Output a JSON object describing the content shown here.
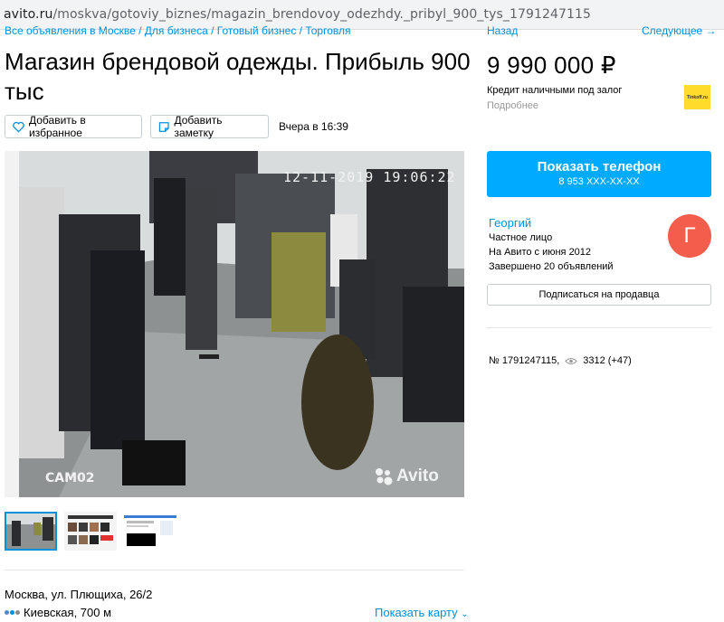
{
  "browser": {
    "url_host": "avito.ru",
    "url_path": "/moskva/gotoviy_biznes/magazin_brendovoy_odezhdy._pribyl_900_tys_1791247115"
  },
  "breadcrumbs": "Все объявления в Москве / Для бизнеса / Готовый бизнес / Торговля",
  "nav": {
    "prev": "Назад",
    "next": "Следующее →"
  },
  "listing": {
    "title": "Магазин брендовой одежды. Прибыль 900 тыс",
    "favorite_label": "Добавить в избранное",
    "note_label": "Добавить заметку",
    "date": "Вчера в 16:39"
  },
  "photo": {
    "timestamp": "12-11-2019 19:06:22",
    "camera": "CAM02",
    "watermark": "Avito"
  },
  "location": {
    "address": "Москва, ул. Плющиха, 26/2",
    "metro": "Киевская, 700 м",
    "metro_colors": [
      "#4b8ad6",
      "#0091d9",
      "#8a8a8a"
    ],
    "map_link": "Показать карту"
  },
  "price": {
    "value": "9 990 000 ₽",
    "credit_text": "Кредит наличными под залог",
    "more": "Подробнее",
    "bank_logo": "Tinkoff.ru"
  },
  "contact": {
    "button_label": "Показать телефон",
    "phone": "8 953 XXX-XX-XX"
  },
  "seller": {
    "name": "Георгий",
    "type": "Частное лицо",
    "since": "На Авито с июня 2012",
    "completed": "Завершено 20 объявлений",
    "avatar_letter": "Г",
    "subscribe_label": "Подписаться на продавца"
  },
  "stats": {
    "ad_number": "№ 1791247115,",
    "views": "3312 (+47)"
  },
  "colors": {
    "link": "#0091d9",
    "primary_button": "#00aaff",
    "avatar": "#f25e4b",
    "bank": "#ffdd2d"
  }
}
